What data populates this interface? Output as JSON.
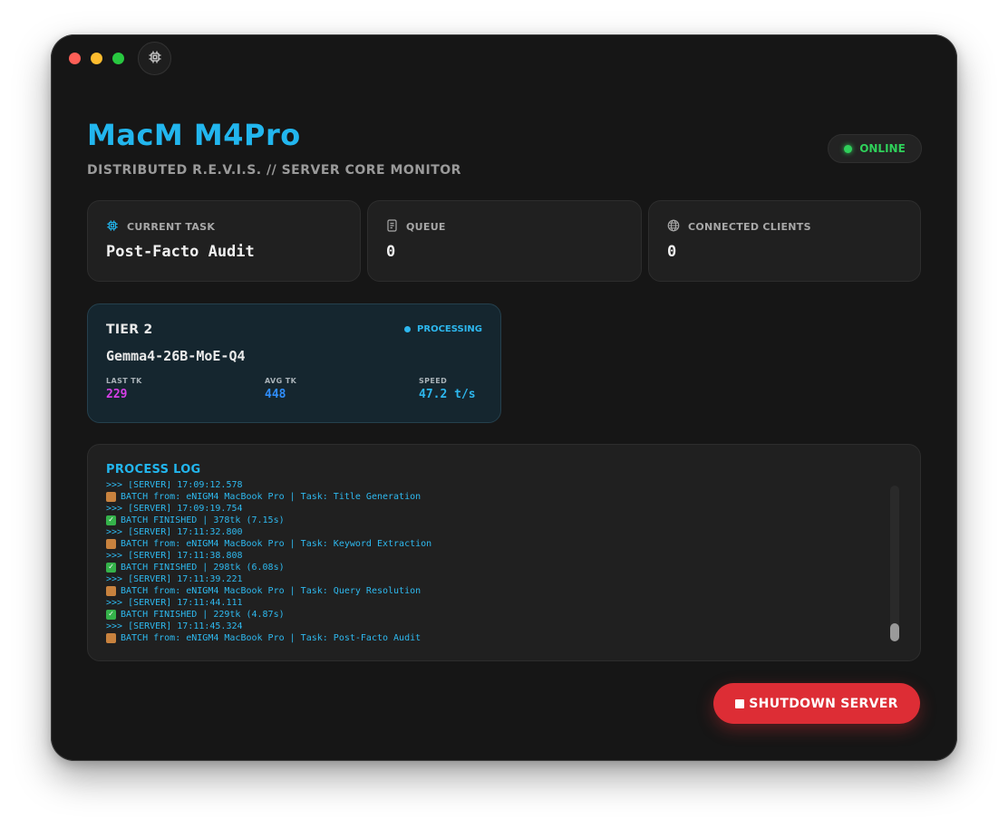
{
  "header": {
    "title": "MacM M4Pro",
    "subtitle": "DISTRIBUTED R.E.V.I.S. // SERVER CORE MONITOR",
    "status": "ONLINE"
  },
  "cards": [
    {
      "label": "CURRENT TASK",
      "value": "Post-Facto Audit",
      "icon": "cpu-icon"
    },
    {
      "label": "QUEUE",
      "value": "0",
      "icon": "document-icon"
    },
    {
      "label": "CONNECTED CLIENTS",
      "value": "0",
      "icon": "globe-icon"
    }
  ],
  "tier": {
    "title": "TIER 2",
    "status": "PROCESSING",
    "model": "Gemma4-26B-MoE-Q4",
    "metrics": [
      {
        "label": "LAST TK",
        "value": "229",
        "color": "#d63fe8"
      },
      {
        "label": "AVG TK",
        "value": "448",
        "color": "#2f8dfa"
      },
      {
        "label": "SPEED",
        "value": "47.2 t/s",
        "color": "#2db7ee"
      }
    ]
  },
  "log": {
    "title": "PROCESS LOG",
    "lines": [
      {
        "icon": "none",
        "text": ">>> [SERVER] 17:09:12.578"
      },
      {
        "icon": "package-icon",
        "text": "BATCH from: eNIGM4 MacBook Pro | Task: Title Generation"
      },
      {
        "icon": "none",
        "text": ">>> [SERVER] 17:09:19.754"
      },
      {
        "icon": "check-icon",
        "text": "BATCH FINISHED | 378tk (7.15s)"
      },
      {
        "icon": "none",
        "text": ">>> [SERVER] 17:11:32.800"
      },
      {
        "icon": "package-icon",
        "text": "BATCH from: eNIGM4 MacBook Pro | Task: Keyword Extraction"
      },
      {
        "icon": "none",
        "text": ">>> [SERVER] 17:11:38.808"
      },
      {
        "icon": "check-icon",
        "text": "BATCH FINISHED | 298tk (6.08s)"
      },
      {
        "icon": "none",
        "text": ">>> [SERVER] 17:11:39.221"
      },
      {
        "icon": "package-icon",
        "text": "BATCH from: eNIGM4 MacBook Pro | Task: Query Resolution"
      },
      {
        "icon": "none",
        "text": ">>> [SERVER] 17:11:44.111"
      },
      {
        "icon": "check-icon",
        "text": "BATCH FINISHED | 229tk (4.87s)"
      },
      {
        "icon": "none",
        "text": ">>> [SERVER] 17:11:45.324"
      },
      {
        "icon": "package-icon",
        "text": "BATCH from: eNIGM4 MacBook Pro | Task: Post-Facto Audit"
      }
    ]
  },
  "actions": {
    "shutdown_label": "SHUTDOWN SERVER"
  },
  "colors": {
    "accent": "#22b6ee",
    "online": "#2fd05a",
    "danger": "#dd2d35"
  }
}
